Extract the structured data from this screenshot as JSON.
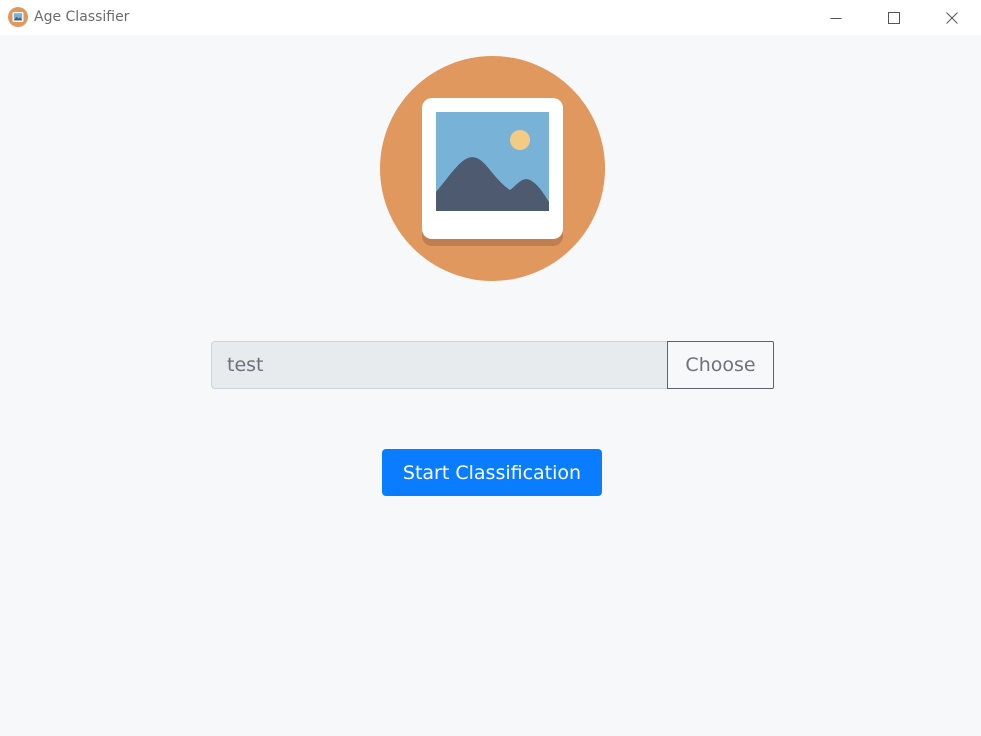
{
  "window": {
    "title": "Age Classifier",
    "minimize_icon": "minimize-icon",
    "maximize_icon": "maximize-icon",
    "close_icon": "close-icon"
  },
  "hero": {
    "icon": "image-placeholder-icon",
    "colors": {
      "circle": "#e0985f",
      "frame": "#ffffff",
      "frame_shadow": "#c07f50",
      "sky": "#78b2d6",
      "sun": "#f4cb84",
      "mountains": "#4e5a70"
    }
  },
  "file_picker": {
    "value": "test",
    "button_label": "Choose"
  },
  "actions": {
    "start_label": "Start Classification",
    "accent_color": "#0a7cff"
  }
}
